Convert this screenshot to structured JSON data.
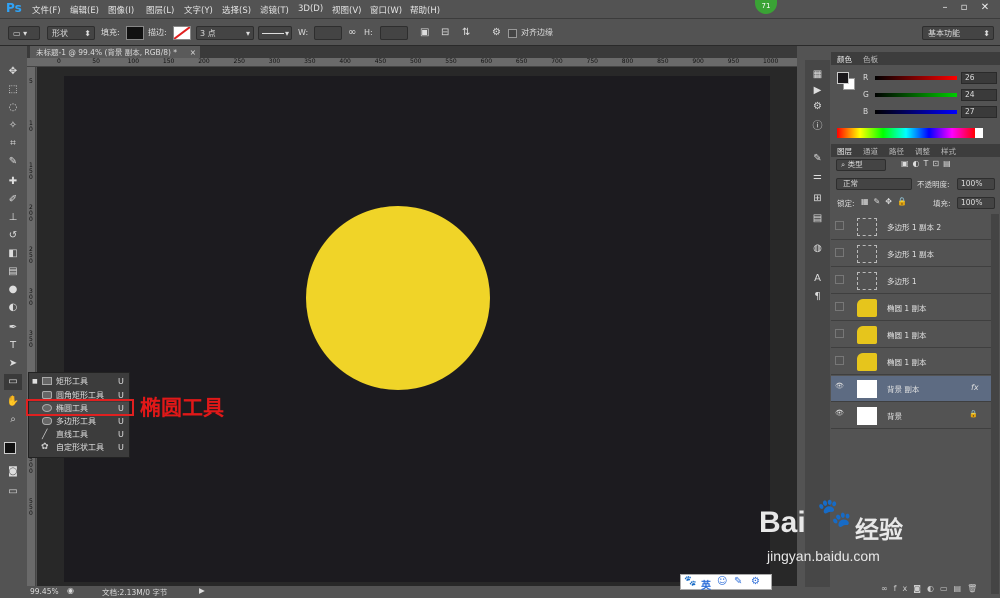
{
  "app": {
    "logo": "Ps",
    "badge": "71"
  },
  "menubar": [
    "文件(F)",
    "编辑(E)",
    "图像(I)",
    "图层(L)",
    "文字(Y)",
    "选择(S)",
    "滤镜(T)",
    "3D(D)",
    "视图(V)",
    "窗口(W)",
    "帮助(H)"
  ],
  "options": {
    "mode": "形状",
    "fill_label": "填充:",
    "stroke_label": "描边:",
    "stroke_width": "3 点",
    "w_label": "W:",
    "h_label": "H:",
    "align_edges": "对齐边缘",
    "workspace": "基本功能"
  },
  "document": {
    "tab_title": "未标题-1 @ 99.4% (背景 副本, RGB/8) *",
    "zoom": "99.45%",
    "doc_info": "文档:2.13M/0 字节"
  },
  "ruler": {
    "h_ticks": [
      "0",
      "50",
      "100",
      "150",
      "200",
      "250",
      "300",
      "350",
      "400",
      "450",
      "500",
      "550",
      "600",
      "650",
      "700",
      "750",
      "800",
      "850",
      "900",
      "950",
      "1000"
    ],
    "v_ticks": [
      "5",
      "1 0",
      "1 5 0",
      "2 0 0",
      "2 5 0",
      "3 0 0",
      "3 5 0",
      "4 0 0",
      "4 5 0",
      "5 0 0",
      "5 5 0"
    ]
  },
  "canvas": {
    "circle_color": "#f0d428",
    "background": "#1c1b1f"
  },
  "shape_flyout": {
    "items": [
      {
        "label": "矩形工具",
        "key": "U"
      },
      {
        "label": "圆角矩形工具",
        "key": "U"
      },
      {
        "label": "椭圆工具",
        "key": "U"
      },
      {
        "label": "多边形工具",
        "key": "U"
      },
      {
        "label": "直线工具",
        "key": "U"
      },
      {
        "label": "自定形状工具",
        "key": "U"
      }
    ],
    "annotation": "椭圆工具",
    "annotation_color": "#e01818"
  },
  "color_panel": {
    "tabs": [
      "颜色",
      "色板"
    ],
    "r_label": "R",
    "g_label": "G",
    "b_label": "B",
    "r": "26",
    "g": "24",
    "b": "27"
  },
  "layers_panel": {
    "tabs": [
      "图层",
      "通道",
      "路径",
      "调整",
      "样式"
    ],
    "filter_kind": "类型",
    "blend_mode": "正常",
    "opacity_label": "不透明度:",
    "opacity": "100%",
    "lock_label": "锁定:",
    "fill_label": "填充:",
    "fill": "100%",
    "layers": [
      {
        "name": "多边形 1 副本 2",
        "kind": "shape"
      },
      {
        "name": "多边形 1 副本",
        "kind": "shape"
      },
      {
        "name": "多边形 1",
        "kind": "shape"
      },
      {
        "name": "椭圆 1 副本",
        "kind": "ellipse"
      },
      {
        "name": "椭圆 1 副本",
        "kind": "ellipse"
      },
      {
        "name": "椭圆 1 副本",
        "kind": "ellipse"
      },
      {
        "name": "背景 副本",
        "kind": "pixel",
        "fx": "fx"
      },
      {
        "name": "背景",
        "kind": "bg"
      }
    ]
  },
  "watermark": {
    "brand_text": "Bai",
    "brand_text2": "经验",
    "url": "jingyan.baidu.com",
    "ime_text": "英"
  }
}
